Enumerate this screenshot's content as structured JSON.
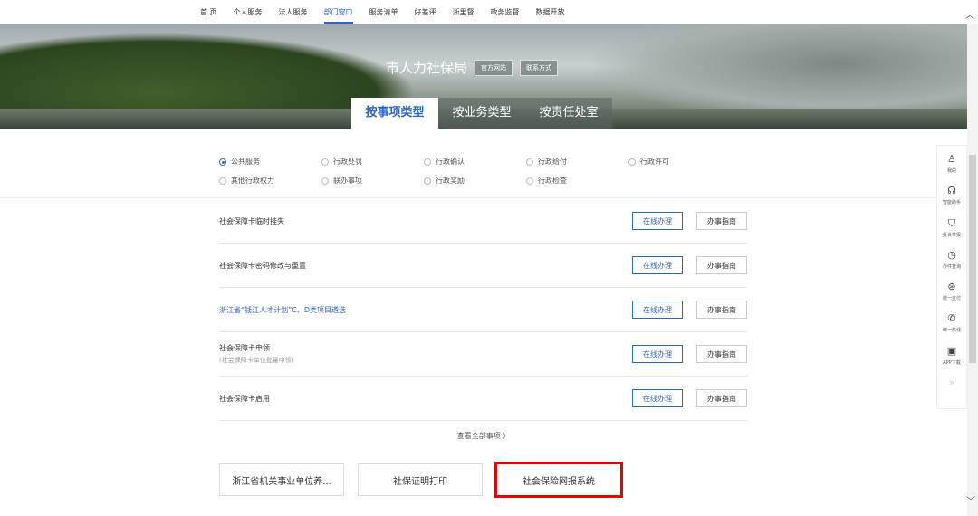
{
  "nav": [
    "首 页",
    "个人服务",
    "法人服务",
    "部门窗口",
    "服务清单",
    "好差评",
    "浙里督",
    "政务监督",
    "数据开放"
  ],
  "dept": {
    "name": "市人力社保局",
    "official": "官方网站",
    "contact": "联系方式"
  },
  "tabs": [
    "按事项类型",
    "按业务类型",
    "按责任处室"
  ],
  "filters": [
    [
      "公共服务",
      "行政处罚",
      "行政确认",
      "行政给付",
      "行政许可"
    ],
    [
      "其他行政权力",
      "联办事项",
      "行政奖励",
      "行政检查"
    ]
  ],
  "items": [
    {
      "title": "社会保障卡临时挂失",
      "sub": ""
    },
    {
      "title": "社会保障卡密码修改与重置",
      "sub": ""
    },
    {
      "title": "浙江省“钱江人才计划”C、D类项目遴选",
      "sub": ""
    },
    {
      "title": "社会保障卡申领",
      "sub": "(社会保障卡单位批量申领)"
    },
    {
      "title": "社会保障卡启用",
      "sub": ""
    }
  ],
  "online_label": "在线办理",
  "guide_label": "办事指南",
  "more": "查看全部事项  〉",
  "systems": [
    "浙江省机关事业单位养...",
    "社保证明打印",
    "社会保险网报系统"
  ],
  "side": [
    {
      "icon": "♙",
      "label": "我的"
    },
    {
      "icon": "☊",
      "label": "智能助手"
    },
    {
      "icon": "⛉",
      "label": "投诉举报"
    },
    {
      "icon": "◷",
      "label": "办件查询"
    },
    {
      "icon": "⊛",
      "label": "统一支付"
    },
    {
      "icon": "✆",
      "label": "统一热线"
    },
    {
      "icon": "▣",
      "label": "APP下载"
    },
    {
      "icon": "»",
      "label": ""
    }
  ]
}
